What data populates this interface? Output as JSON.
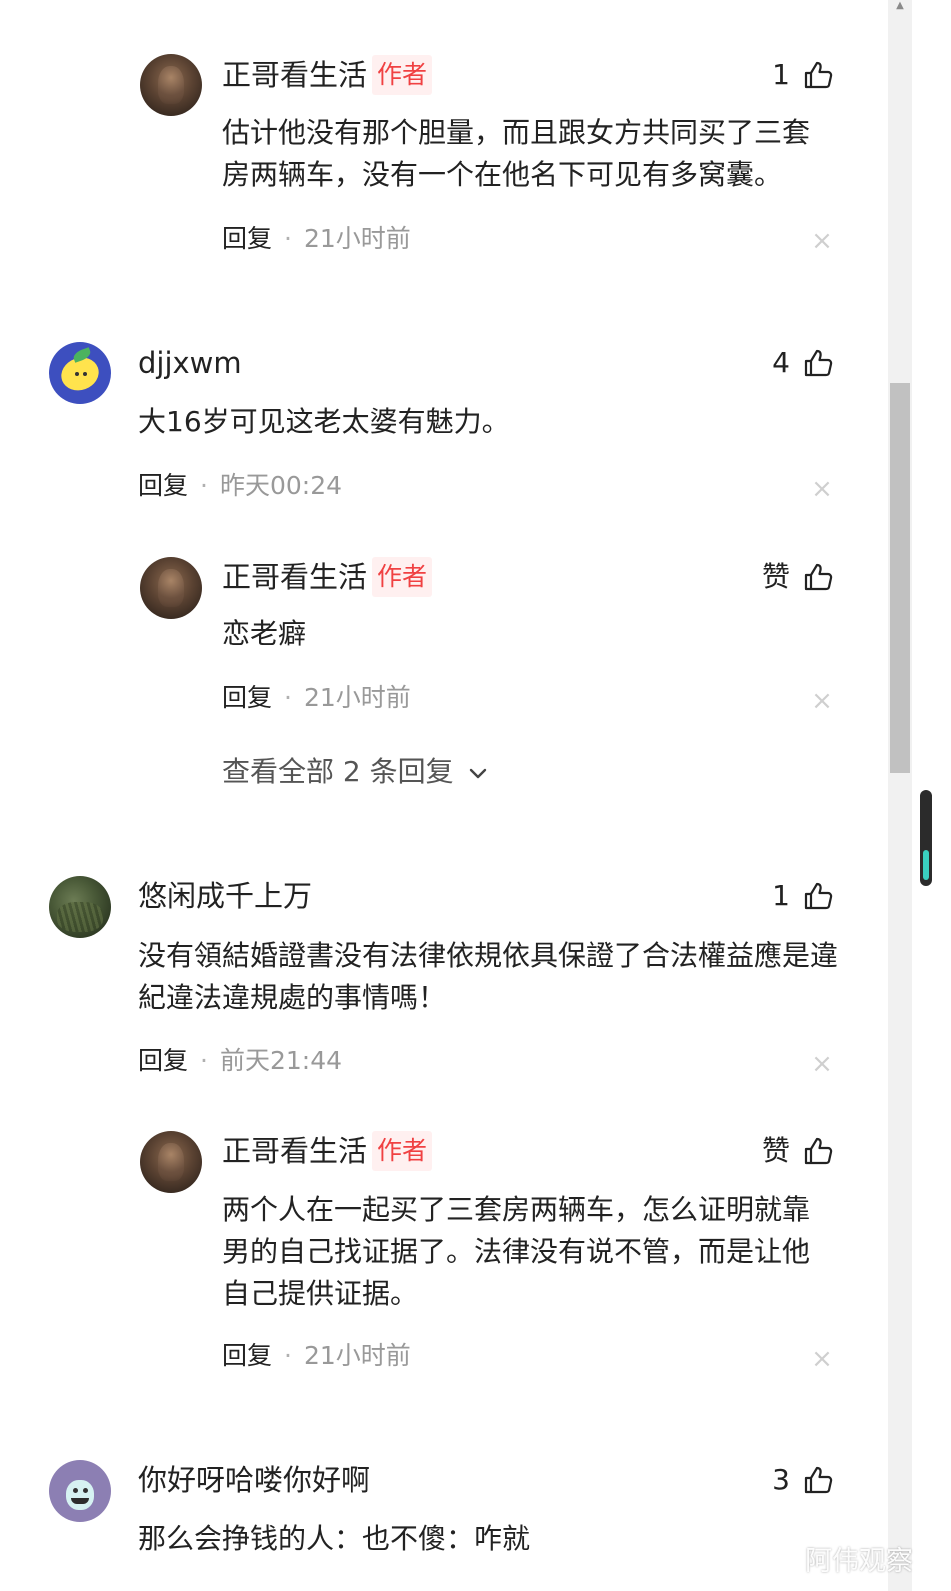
{
  "comments": [
    {
      "name": "正哥看生活",
      "tag": "作者",
      "likes": "1",
      "text": "估计他没有那个胆量，而且跟女方共同买了三套房两辆车，没有一个在他名下可见有多窝囊。",
      "reply": "回复",
      "dot": "·",
      "time": "21小时前",
      "close": "×"
    },
    {
      "name": "djjxwm",
      "likes": "4",
      "text": "大16岁可见这老太婆有魅力。",
      "reply": "回复",
      "dot": "·",
      "time": "昨天00:24",
      "close": "×"
    },
    {
      "name": "正哥看生活",
      "tag": "作者",
      "likes": "赞",
      "text": "恋老癖",
      "reply": "回复",
      "dot": "·",
      "time": "21小时前",
      "close": "×"
    },
    {
      "name": "悠闲成千上万",
      "likes": "1",
      "text": "没有領結婚證書没有法律依規依具保證了合法權益應是違紀違法違規處的事情嗎！",
      "reply": "回复",
      "dot": "·",
      "time": "前天21:44",
      "close": "×"
    },
    {
      "name": "正哥看生活",
      "tag": "作者",
      "likes": "赞",
      "text": "两个人在一起买了三套房两辆车，怎么证明就靠男的自己找证据了。法律没有说不管，而是让他自己提供证据。",
      "reply": "回复",
      "dot": "·",
      "time": "21小时前",
      "close": "×"
    },
    {
      "name": "你好呀哈喽你好啊",
      "likes": "3",
      "text": "那么会挣钱的人：也不傻：咋就"
    }
  ],
  "expand_replies": "查看全部 2 条回复",
  "watermark": "阿伟观察",
  "icons": {
    "like": "thumbs-up-icon",
    "expand": "chevron-down-icon",
    "close": "close-icon"
  },
  "colors": {
    "author_tag": "#f04142",
    "author_tag_bg": "#fff0f0",
    "meta_time": "#999999"
  }
}
